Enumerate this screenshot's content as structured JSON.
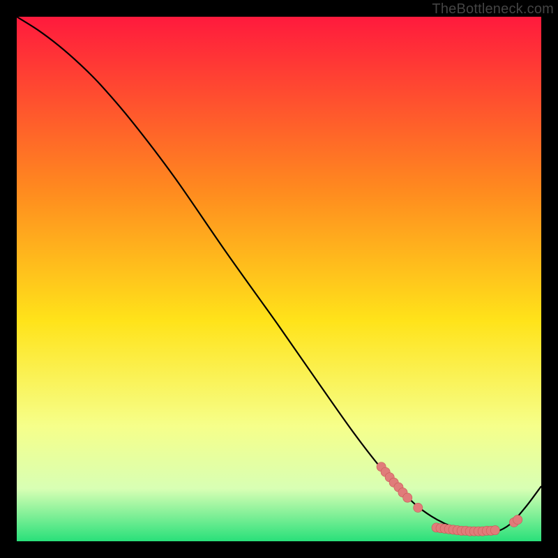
{
  "watermark": {
    "text": "TheBottleneck.com"
  },
  "colors": {
    "black": "#000000",
    "curve": "#000000",
    "marker_fill": "#e07c7a",
    "marker_stroke": "#c95755",
    "grad_top": "#ff1a3d",
    "grad_mid_upper": "#ff8a1f",
    "grad_mid": "#ffe31a",
    "grad_lower": "#f6ff8a",
    "grad_pale": "#d8ffb4",
    "grad_green": "#29e07a"
  },
  "chart_data": {
    "type": "line",
    "title": "",
    "xlabel": "",
    "ylabel": "",
    "xlim": [
      0,
      100
    ],
    "ylim": [
      0,
      100
    ],
    "curve": {
      "x": [
        0,
        4,
        8,
        12,
        16,
        22,
        30,
        40,
        50,
        58,
        64,
        69,
        73,
        76,
        79,
        82,
        85,
        88,
        91,
        94,
        97,
        100
      ],
      "y": [
        100,
        97.5,
        94.5,
        91,
        87,
        80,
        69.5,
        55,
        41,
        29.5,
        21,
        14.5,
        10,
        7,
        4.8,
        3.2,
        2.1,
        1.6,
        1.7,
        3.2,
        6.5,
        10.5
      ]
    },
    "markers": [
      {
        "x": 69.5,
        "y": 14.2
      },
      {
        "x": 70.3,
        "y": 13.2
      },
      {
        "x": 71.1,
        "y": 12.2
      },
      {
        "x": 71.9,
        "y": 11.2
      },
      {
        "x": 72.8,
        "y": 10.3
      },
      {
        "x": 73.6,
        "y": 9.3
      },
      {
        "x": 74.5,
        "y": 8.3
      },
      {
        "x": 76.5,
        "y": 6.4
      },
      {
        "x": 80.0,
        "y": 2.6
      },
      {
        "x": 80.8,
        "y": 2.5
      },
      {
        "x": 81.6,
        "y": 2.4
      },
      {
        "x": 82.4,
        "y": 2.3
      },
      {
        "x": 83.2,
        "y": 2.2
      },
      {
        "x": 84.0,
        "y": 2.1
      },
      {
        "x": 84.8,
        "y": 2.0
      },
      {
        "x": 85.6,
        "y": 2.0
      },
      {
        "x": 86.4,
        "y": 1.9
      },
      {
        "x": 87.2,
        "y": 1.9
      },
      {
        "x": 88.0,
        "y": 1.9
      },
      {
        "x": 88.8,
        "y": 1.9
      },
      {
        "x": 89.6,
        "y": 2.0
      },
      {
        "x": 90.4,
        "y": 2.0
      },
      {
        "x": 91.2,
        "y": 2.1
      },
      {
        "x": 94.8,
        "y": 3.6
      },
      {
        "x": 95.5,
        "y": 4.1
      }
    ],
    "gradient_stops": [
      {
        "offset": 0,
        "key": "grad_top"
      },
      {
        "offset": 33,
        "key": "grad_mid_upper"
      },
      {
        "offset": 58,
        "key": "grad_mid"
      },
      {
        "offset": 78,
        "key": "grad_lower"
      },
      {
        "offset": 90,
        "key": "grad_pale"
      },
      {
        "offset": 100,
        "key": "grad_green"
      }
    ]
  }
}
